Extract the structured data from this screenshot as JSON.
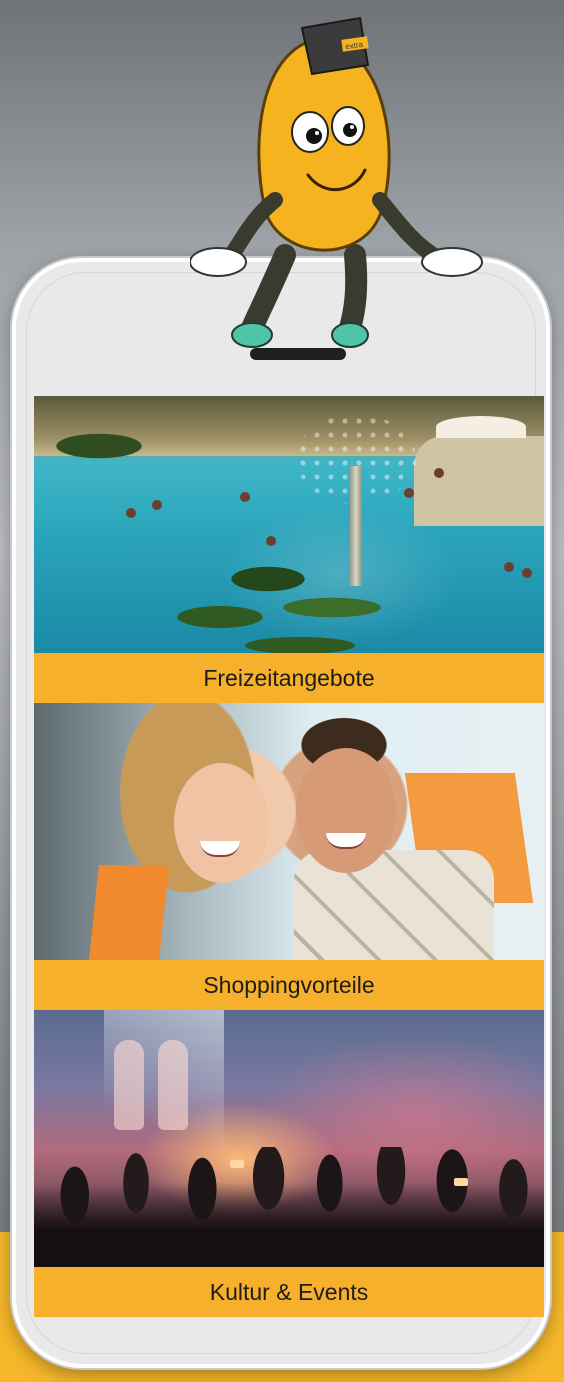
{
  "colors": {
    "accent_bar": "#f7b02b",
    "phone_body": "#e9e9ea",
    "phone_frame": "#ffffff",
    "mascot_body": "#f5b31f",
    "mascot_cap": "#3b3b3b",
    "mascot_shoes": "#4fc4a8"
  },
  "mascot": {
    "cap_text": "extra",
    "icon": "lightbulb-mascot-icon"
  },
  "tiles": [
    {
      "label": "Freizeitangebote",
      "image": "swimming-pool-photo"
    },
    {
      "label": "Shoppingvorteile",
      "image": "couple-shopping-photo"
    },
    {
      "label": "Kultur & Events",
      "image": "concert-crowd-photo"
    }
  ]
}
